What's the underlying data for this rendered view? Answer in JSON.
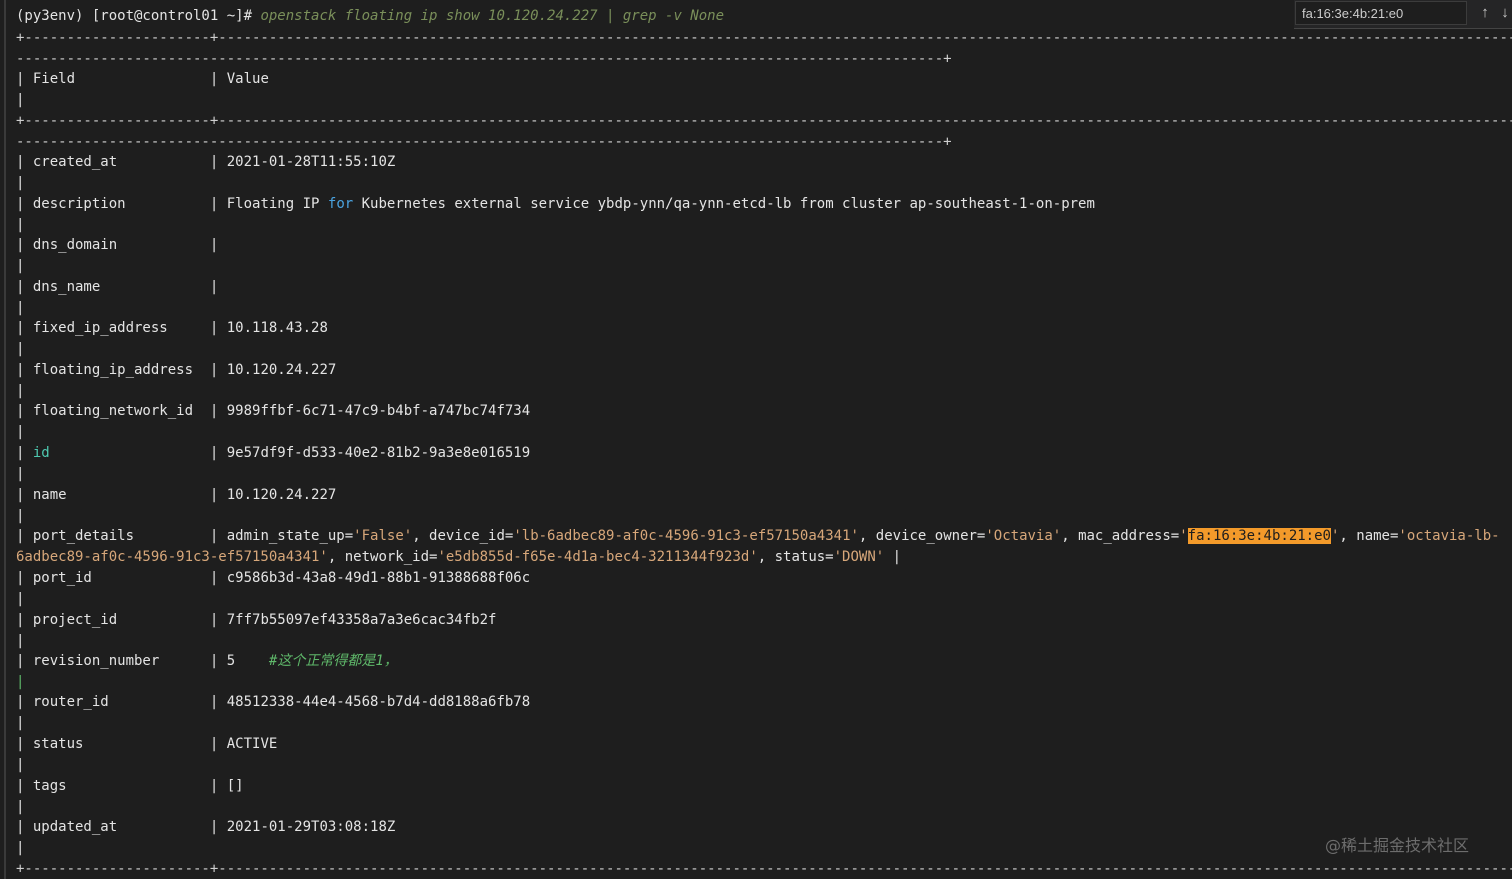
{
  "prompt": {
    "user": "(py3env) [root@control01 ~]# ",
    "command": "openstack floating ip show 10.120.24.227 | grep -v None"
  },
  "table": {
    "border_top": "+----------------------+--------------------------------------------------------------------------------------------------------------------------------------------------------------------------------------------------------",
    "border_wrap": "--------------------------------------------------------------------------------------------------------------+",
    "header_field": "Field",
    "header_value": "Value",
    "sep": "|",
    "desc_pre": "Floating IP ",
    "desc_kw": "for",
    "desc_post": " Kubernetes external service ybdp-ynn/qa-ynn-etcd-lb from cluster ap-southeast-1-on-prem",
    "port_details": {
      "p1": "admin_state_up=",
      "v1": "'False'",
      "p2": ", device_id=",
      "v2": "'lb-6adbec89-af0c-4596-91c3-ef57150a4341'",
      "p3": ", device_owner=",
      "v3": "'Octavia'",
      "p4": ", mac_address=",
      "q1": "'",
      "mac": "fa:16:3e:4b:21:e0",
      "q2": "'",
      "p5": ", name=",
      "v5a": "'octavia-lb-",
      "v5b": "6adbec89-af0c-4596-91c3-ef57150a4341'",
      "p6": ", network_id=",
      "v6": "'e5db855d-f65e-4d1a-bec4-3211344f923d'",
      "p7": ", status=",
      "v7": "'DOWN'",
      "p8": " |"
    },
    "revision_comment": "#这个正常得都是1，",
    "rows": [
      {
        "field": "created_at",
        "value": "2021-01-28T11:55:10Z"
      },
      {
        "field": "description",
        "value": ""
      },
      {
        "field": "dns_domain",
        "value": ""
      },
      {
        "field": "dns_name",
        "value": ""
      },
      {
        "field": "fixed_ip_address",
        "value": "10.118.43.28"
      },
      {
        "field": "floating_ip_address",
        "value": "10.120.24.227"
      },
      {
        "field": "floating_network_id",
        "value": "9989ffbf-6c71-47c9-b4bf-a747bc74f734"
      },
      {
        "field": "id",
        "value": "9e57df9f-d533-40e2-81b2-9a3e8e016519"
      },
      {
        "field": "name",
        "value": "10.120.24.227"
      },
      {
        "field": "port_details",
        "value": ""
      },
      {
        "field": "port_id",
        "value": "c9586b3d-43a8-49d1-88b1-91388688f06c"
      },
      {
        "field": "project_id",
        "value": "7ff7b55097ef43358a7a3e6cac34fb2f"
      },
      {
        "field": "revision_number",
        "value": "5"
      },
      {
        "field": "router_id",
        "value": "48512338-44e4-4568-b7d4-dd8188a6fb78"
      },
      {
        "field": "status",
        "value": "ACTIVE"
      },
      {
        "field": "tags",
        "value": "[]"
      },
      {
        "field": "updated_at",
        "value": "2021-01-29T03:08:18Z"
      }
    ]
  },
  "find": {
    "value": "fa:16:3e:4b:21:e0",
    "prev_icon": "arrow-up-icon",
    "next_icon": "arrow-down-icon"
  },
  "watermark": "@稀土掘金技术社区"
}
